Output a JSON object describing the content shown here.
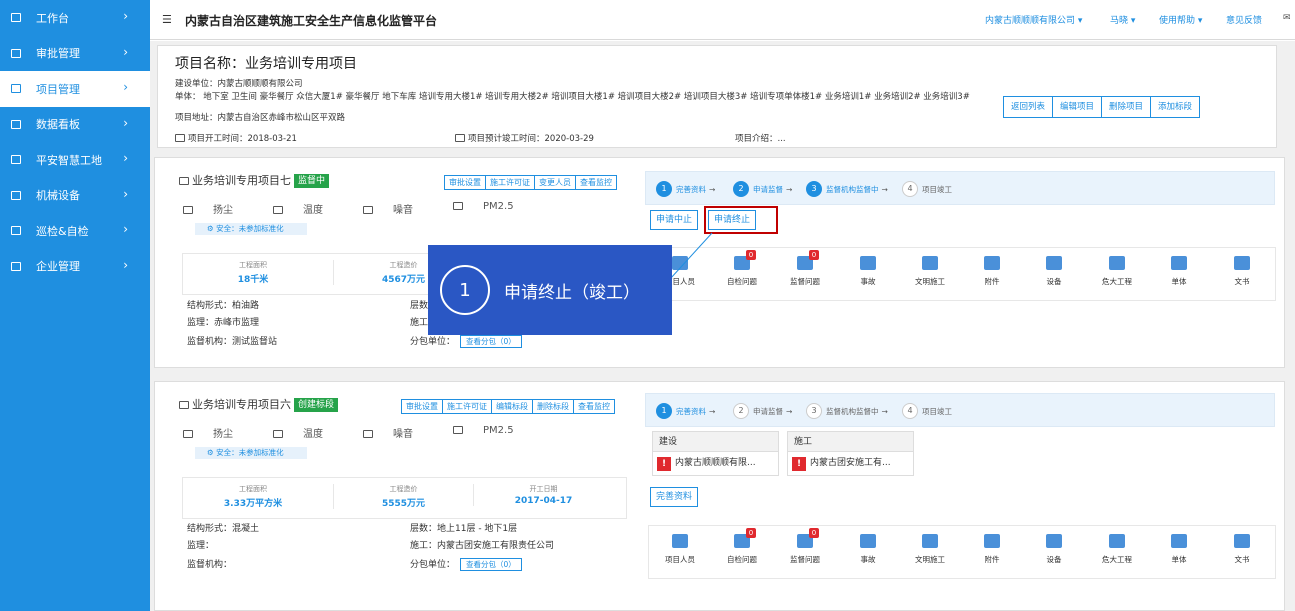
{
  "sidebar": {
    "items": [
      {
        "label": "工作台",
        "icon": "monitor-icon"
      },
      {
        "label": "审批管理",
        "icon": "table-icon"
      },
      {
        "label": "项目管理",
        "icon": "building-icon",
        "active": true
      },
      {
        "label": "数据看板",
        "icon": "chart-icon"
      },
      {
        "label": "平安智慧工地",
        "icon": "drill-icon"
      },
      {
        "label": "机械设备",
        "icon": "machine-icon"
      },
      {
        "label": "巡检&自检",
        "icon": "checklist-icon"
      },
      {
        "label": "企业管理",
        "icon": "company-icon"
      }
    ]
  },
  "topbar": {
    "title": "内蒙古自治区建筑施工安全生产信息化监管平台",
    "company": "内蒙古顺顺顺有限公司",
    "user": "马晓",
    "help": "使用帮助",
    "feedback": "意见反馈"
  },
  "project": {
    "name": "项目名称：业务培训专用项目",
    "builder": "建设单位：内蒙古顺顺顺有限公司",
    "units": "单体：  地下室  卫生间  豪华餐厅  众信大厦1#  豪华餐厅  地下车库  培训专用大楼1#  培训专用大楼2#  培训项目大楼1#  培训项目大楼2#  培训项目大楼3#  培训专项单体楼1#  业务培训1#  业务培训2#  业务培训3#",
    "address": "项目地址：内蒙古自治区赤峰市松山区平双路",
    "start": "项目开工时间：2018-03-21",
    "expected_end": "项目预计竣工时间：2020-03-29",
    "intro": "项目介绍：...",
    "buttons": [
      "返回列表",
      "编辑项目",
      "删除项目",
      "添加标段"
    ]
  },
  "card1": {
    "title": "业务培训专用项目七",
    "status": "监督中",
    "buttons": [
      "审批设置",
      "施工许可证",
      "变更人员",
      "查看监控"
    ],
    "env": [
      "扬尘",
      "温度",
      "噪音",
      "PM2.5"
    ],
    "safety": "安全：未参加标准化",
    "stats": [
      {
        "label": "工程面积",
        "value": "18千米"
      },
      {
        "label": "工程造价",
        "value": "4567万元"
      }
    ],
    "structure": "结构形式：柏油路",
    "supervisor": "监理：赤峰市监理",
    "agency": "监督机构：测试监督站",
    "floors": "层数",
    "construction": "施工",
    "subcontract": "分包单位：",
    "sub_btn": "查看分包（0）",
    "steps": [
      "完善资料",
      "申请监督",
      "监督机构监督中",
      "项目竣工"
    ],
    "step_nums": [
      "1",
      "2",
      "3",
      "4"
    ],
    "apply_stop": "申请中止",
    "apply_end": "申请终止",
    "icons": [
      {
        "label": "项目人员",
        "icon": "people-icon"
      },
      {
        "label": "自检问题",
        "icon": "inspect-icon",
        "badge": "0"
      },
      {
        "label": "监督问题",
        "icon": "shield-icon",
        "badge": "0"
      },
      {
        "label": "事故",
        "icon": "megaphone-icon"
      },
      {
        "label": "文明施工",
        "icon": "worker-icon"
      },
      {
        "label": "附件",
        "icon": "folder-icon"
      },
      {
        "label": "设备",
        "icon": "crane-icon"
      },
      {
        "label": "危大工程",
        "icon": "warning-icon"
      },
      {
        "label": "单体",
        "icon": "building-block-icon"
      },
      {
        "label": "文书",
        "icon": "document-icon"
      }
    ]
  },
  "card2": {
    "title": "业务培训专用项目六",
    "status": "创建标段",
    "buttons": [
      "审批设置",
      "施工许可证",
      "编辑标段",
      "删除标段",
      "查看监控"
    ],
    "env": [
      "扬尘",
      "温度",
      "噪音",
      "PM2.5"
    ],
    "safety": "安全：未参加标准化",
    "stats": [
      {
        "label": "工程面积",
        "value": "3.33万平方米"
      },
      {
        "label": "工程造价",
        "value": "5555万元"
      },
      {
        "label": "开工日期",
        "value": "2017-04-17"
      }
    ],
    "structure": "结构形式：混凝土",
    "supervisor": "监理：",
    "agency": "监督机构：",
    "floors": "层数：地上11层 - 地下1层",
    "construction": "施工：内蒙古团安施工有限责任公司",
    "subcontract": "分包单位：",
    "sub_btn": "查看分包（0）",
    "steps": [
      "完善资料",
      "申请监督",
      "监督机构监督中",
      "项目竣工"
    ],
    "step_nums": [
      "1",
      "2",
      "3",
      "4"
    ],
    "parties": [
      {
        "head": "建设",
        "body": "内蒙古顺顺顺有限..."
      },
      {
        "head": "施工",
        "body": "内蒙古团安施工有..."
      }
    ],
    "complete_btn": "完善资料",
    "icons": [
      {
        "label": "项目人员",
        "icon": "people-icon"
      },
      {
        "label": "自检问题",
        "icon": "inspect-icon",
        "badge": "0"
      },
      {
        "label": "监督问题",
        "icon": "shield-icon",
        "badge": "0"
      },
      {
        "label": "事故",
        "icon": "megaphone-icon"
      },
      {
        "label": "文明施工",
        "icon": "worker-icon"
      },
      {
        "label": "附件",
        "icon": "folder-icon"
      },
      {
        "label": "设备",
        "icon": "crane-icon"
      },
      {
        "label": "危大工程",
        "icon": "warning-icon"
      },
      {
        "label": "单体",
        "icon": "building-block-icon"
      },
      {
        "label": "文书",
        "icon": "document-icon"
      }
    ]
  },
  "callout": {
    "number": "1",
    "text": "申请终止（竣工）"
  },
  "colors": {
    "primary": "#1f8fe0",
    "callout": "#2a57c4",
    "badge": "#e0292e",
    "highlight": "#c00000",
    "tag": "#26a34a"
  }
}
